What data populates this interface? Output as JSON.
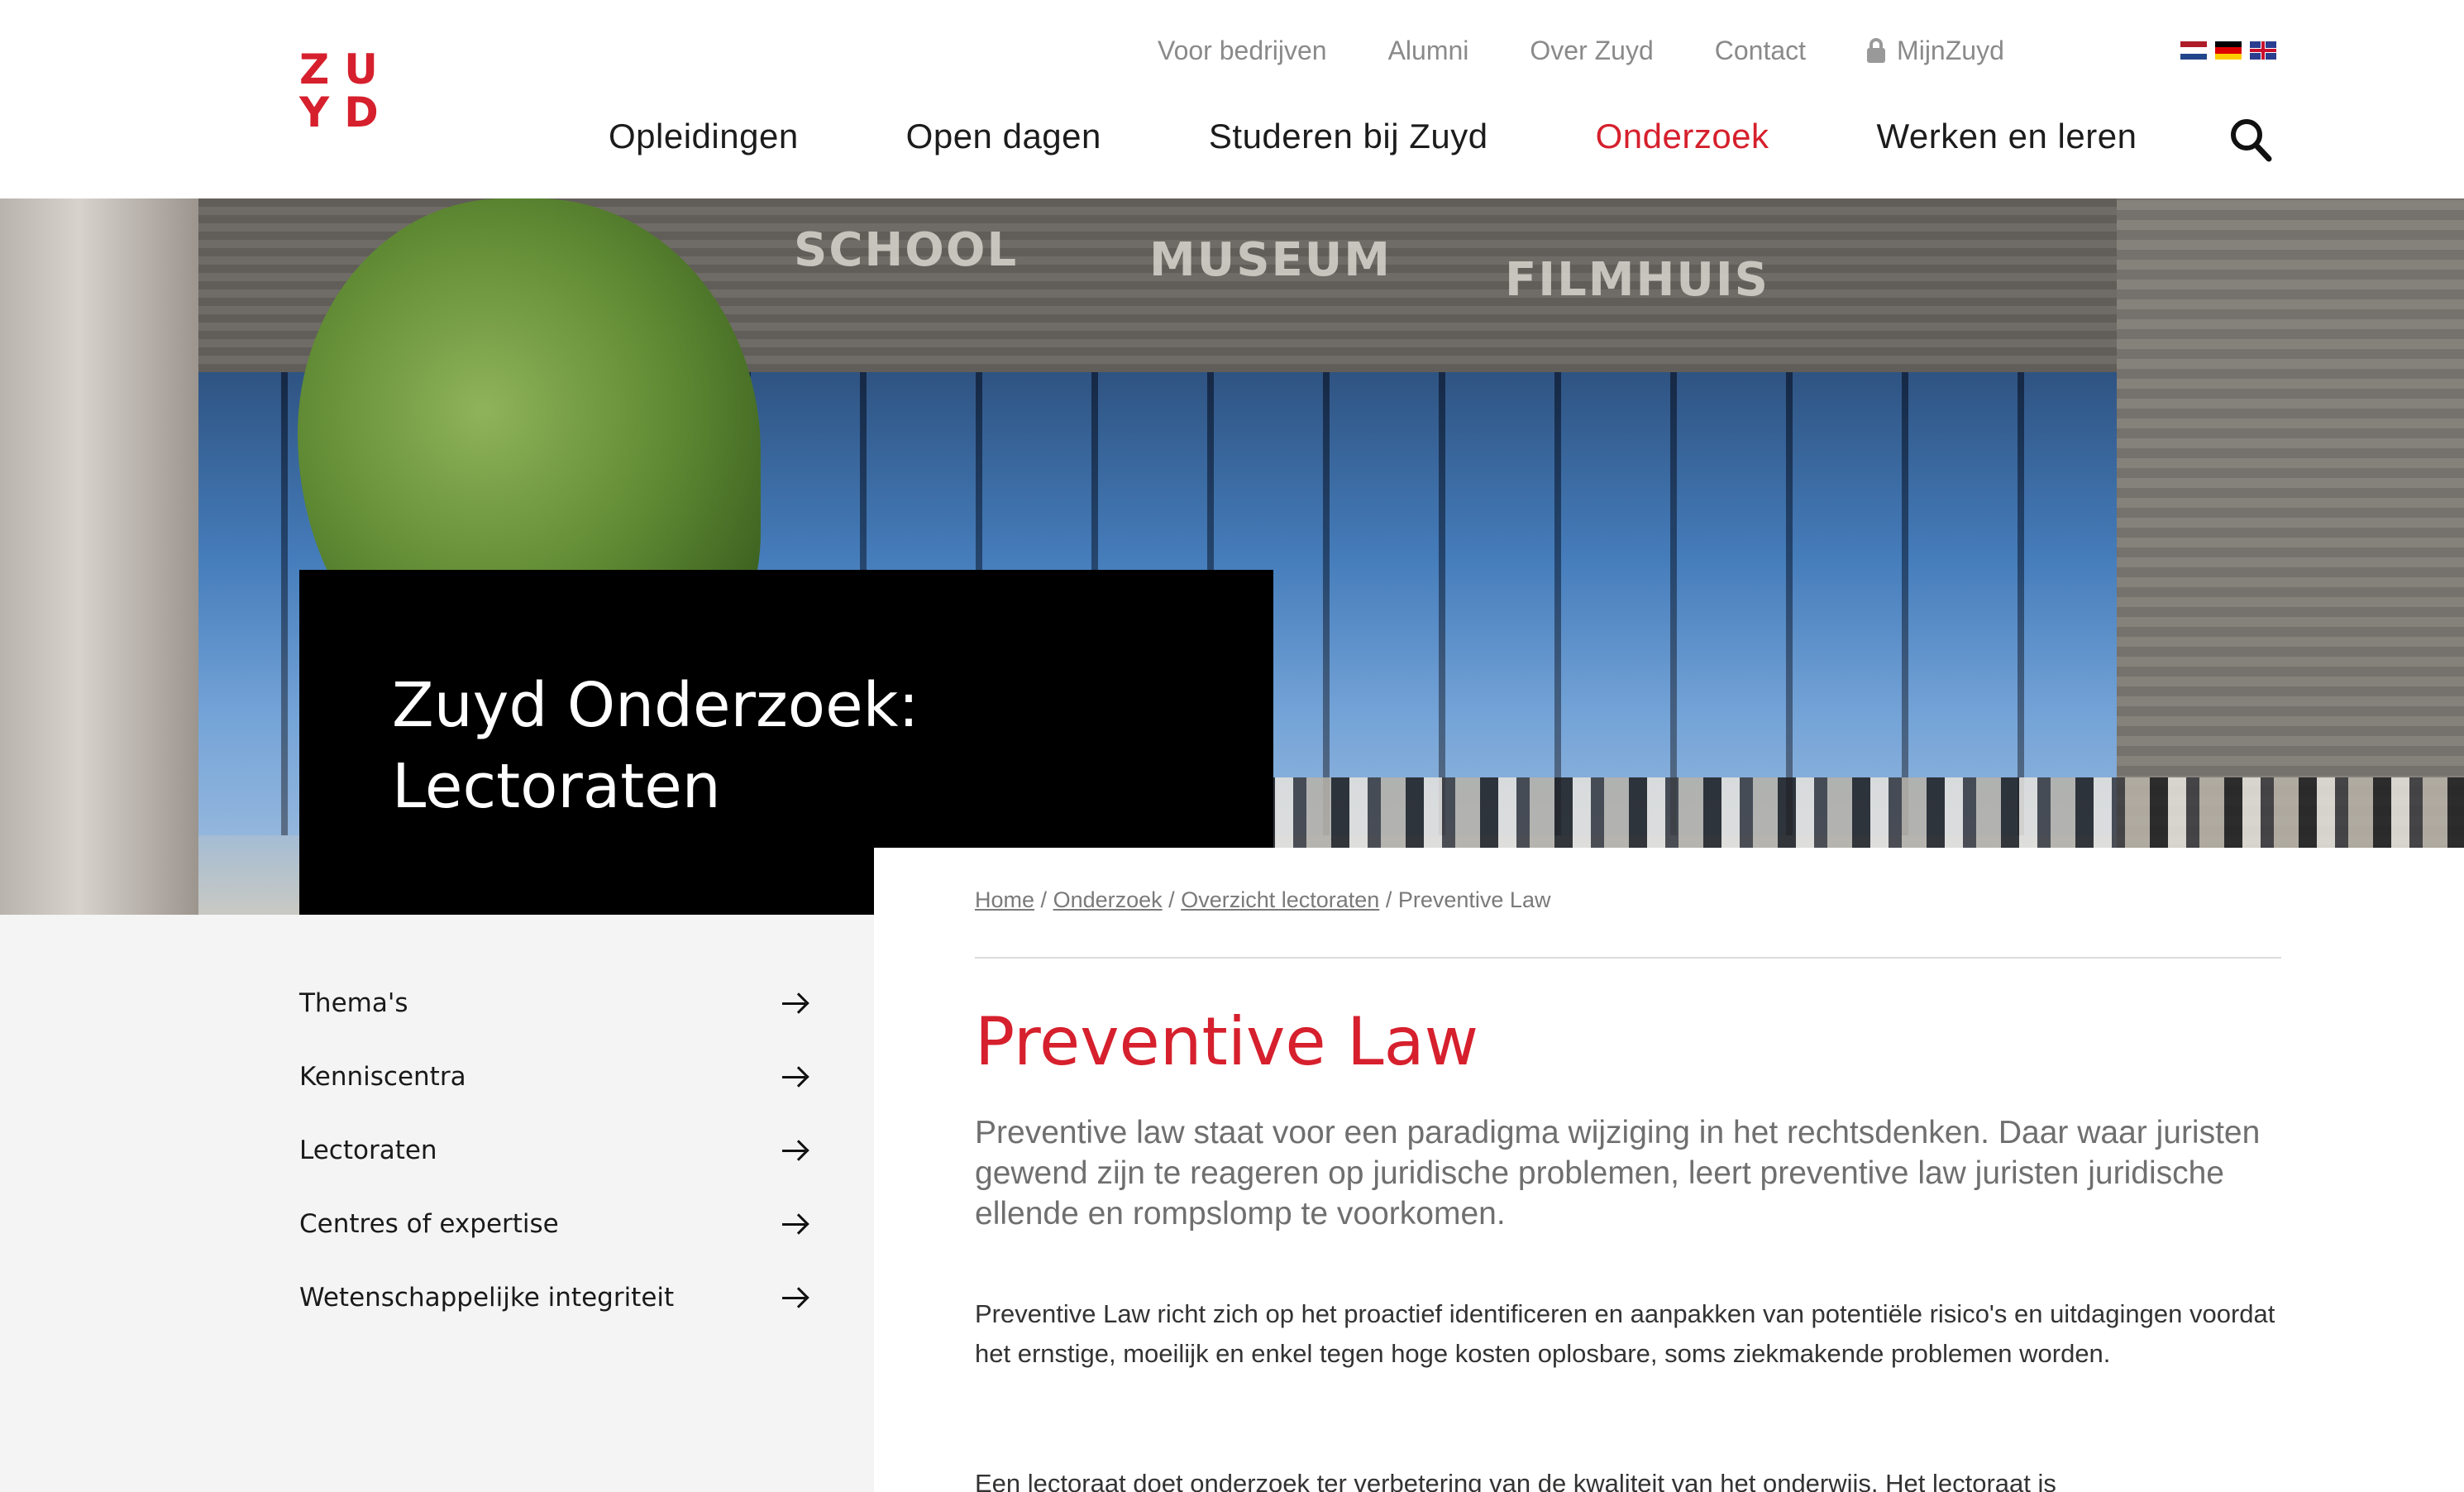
{
  "logo": {
    "line1": "ZU",
    "line2": "YD"
  },
  "topnav": {
    "items": [
      "Voor bedrijven",
      "Alumni",
      "Over Zuyd",
      "Contact"
    ],
    "login": "MijnZuyd"
  },
  "languages": [
    "nl",
    "de",
    "en"
  ],
  "mainnav": {
    "items": [
      {
        "label": "Opleidingen",
        "active": false
      },
      {
        "label": "Open dagen",
        "active": false
      },
      {
        "label": "Studeren bij Zuyd",
        "active": false
      },
      {
        "label": "Onderzoek",
        "active": true
      },
      {
        "label": "Werken en leren",
        "active": false
      }
    ]
  },
  "hero": {
    "title": "Zuyd Onderzoek: Lectoraten",
    "signs": [
      "SCHOOL",
      "MUSEUM",
      "FILMHUIS"
    ]
  },
  "sidebar": {
    "items": [
      {
        "label": "Thema's"
      },
      {
        "label": "Kenniscentra"
      },
      {
        "label": "Lectoraten"
      },
      {
        "label": "Centres of expertise"
      },
      {
        "label": "Wetenschappelijke integriteit"
      }
    ]
  },
  "breadcrumb": {
    "home": "Home",
    "onderzoek": "Onderzoek",
    "overzicht": "Overzicht lectoraten",
    "current": "Preventive Law",
    "separator": "/"
  },
  "page": {
    "title": "Preventive Law",
    "intro": "Preventive law staat voor een paradigma wijziging in het rechtsdenken. Daar waar juristen gewend zijn te reageren op juridische problemen, leert preventive law juristen juridische ellende en rompslomp te voorkomen.",
    "paragraph1": "Preventive Law richt zich op het proactief identificeren en aanpakken van potentiële risico's en uitdagingen voordat het ernstige, moeilijk en enkel tegen hoge kosten oplosbare, soms ziekmakende problemen worden.",
    "paragraph2": "Een lectoraat doet onderzoek ter verbetering van de kwaliteit van het onderwijs. Het lectoraat is"
  },
  "colors": {
    "brand_red": "#d6202d",
    "sidebar_bg": "#f4f4f4",
    "title_box": "#000000"
  }
}
